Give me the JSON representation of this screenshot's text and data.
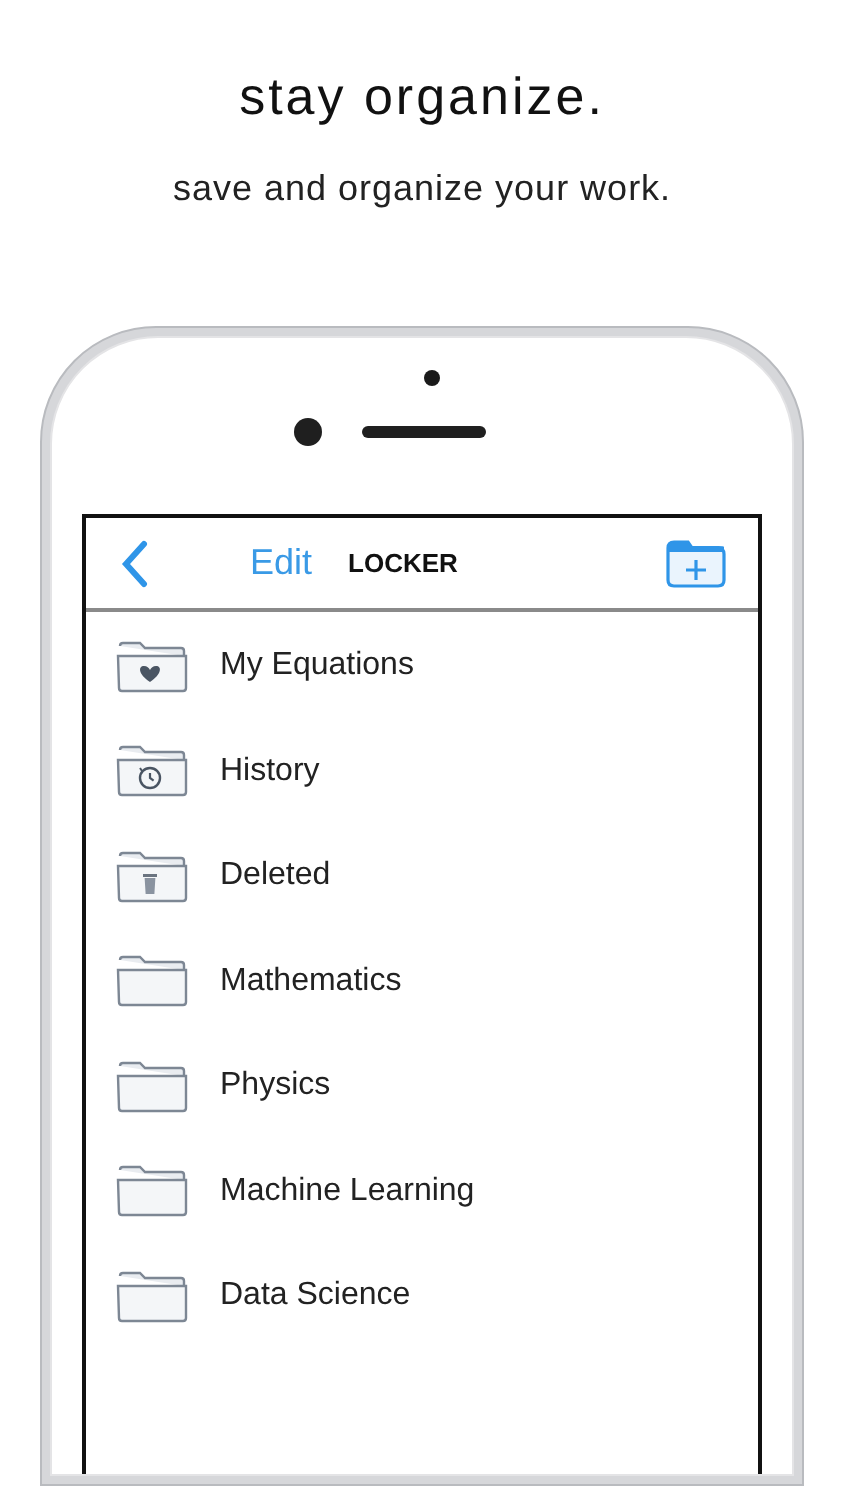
{
  "headline": "stay organize.",
  "subtitle": "save and organize your work.",
  "nav_bar": {
    "edit": "Edit",
    "title": "LOCKER"
  },
  "folders": [
    {
      "name": "My Equations",
      "kind": "heart"
    },
    {
      "name": "History",
      "kind": "clock"
    },
    {
      "name": "Deleted",
      "kind": "trash"
    },
    {
      "name": "Mathematics",
      "kind": "plain"
    },
    {
      "name": "Physics",
      "kind": "plain"
    },
    {
      "name": "Machine Learning",
      "kind": "plain"
    },
    {
      "name": "Data Science",
      "kind": "plain"
    }
  ]
}
